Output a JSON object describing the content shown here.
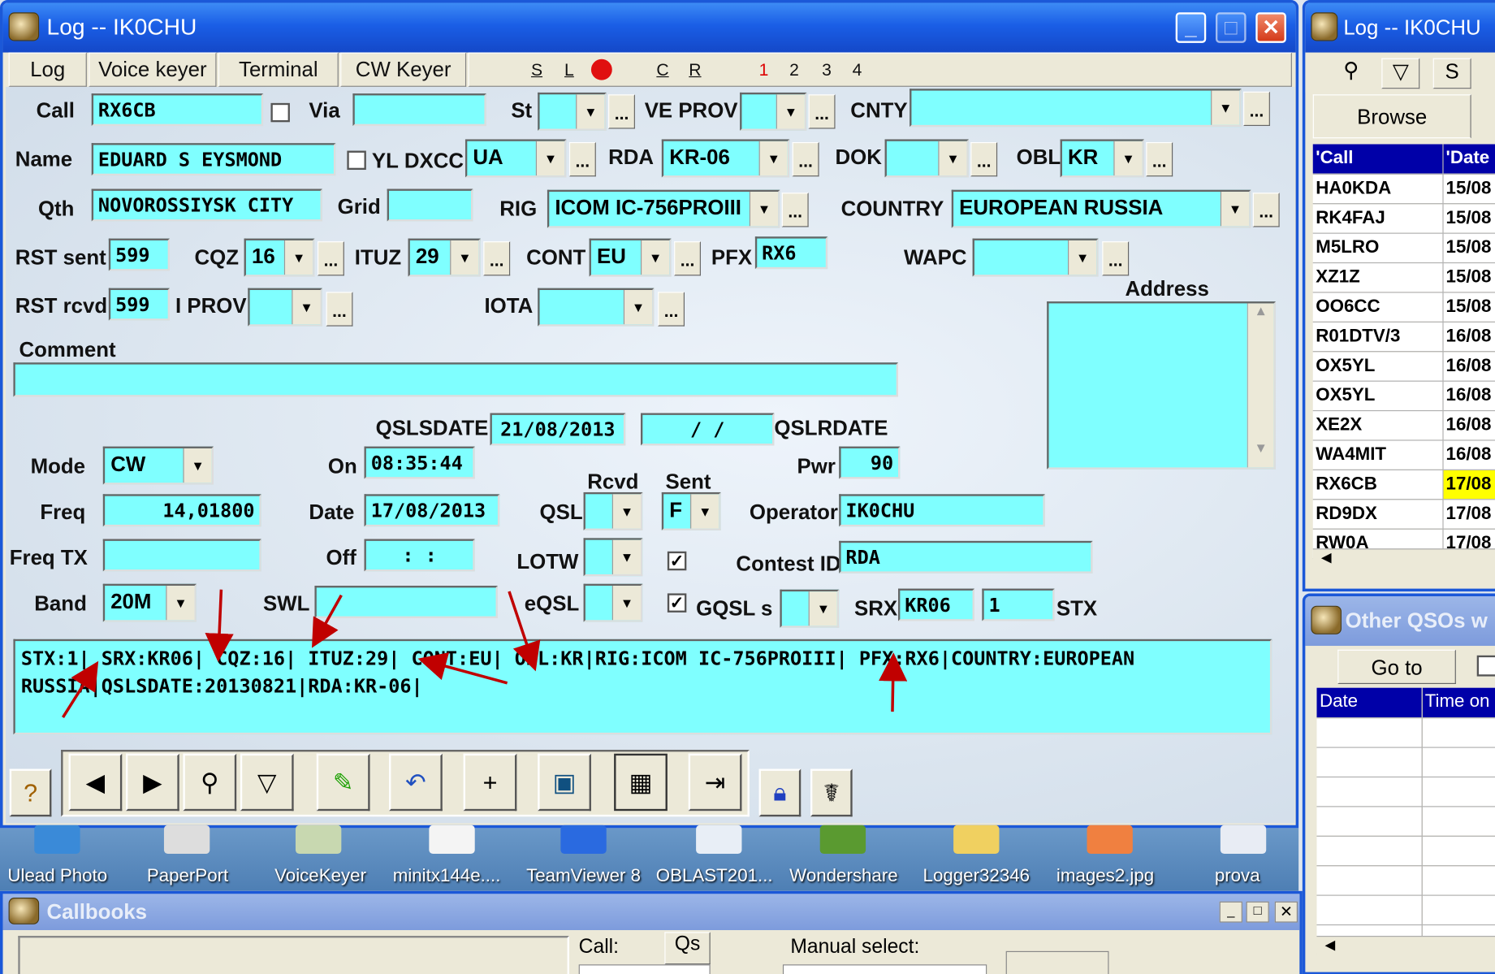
{
  "main_window": {
    "title": "Log -- IK0CHU"
  },
  "menu": {
    "tabs": [
      "Log",
      "Voice keyer",
      "Terminal",
      "CW Keyer"
    ],
    "mini": [
      "S",
      "L",
      "C",
      "R",
      "1",
      "2",
      "3",
      "4"
    ]
  },
  "labels": {
    "call": "Call",
    "via": "Via",
    "st": "St",
    "ve_prov": "VE PROV",
    "cnty": "CNTY",
    "name": "Name",
    "yl": "YL",
    "dxcc": "DXCC",
    "rda": "RDA",
    "dok": "DOK",
    "obl": "OBL",
    "qth": "Qth",
    "grid": "Grid",
    "rig": "RIG",
    "country": "COUNTRY",
    "rst_sent": "RST sent",
    "cqz": "CQZ",
    "ituz": "ITUZ",
    "cont": "CONT",
    "pfx": "PFX",
    "wapc": "WAPC",
    "rst_rcvd": "RST rcvd",
    "i_prov": "I PROV",
    "iota": "IOTA",
    "address": "Address",
    "comment": "Comment",
    "qslsdate": "QSLSDATE",
    "qslrdate": "QSLRDATE",
    "mode": "Mode",
    "on": "On",
    "pwr": "Pwr",
    "rcvd": "Rcvd",
    "sent": "Sent",
    "freq": "Freq",
    "date": "Date",
    "qsl": "QSL",
    "operator": "Operator",
    "freq_tx": "Freq TX",
    "off": "Off",
    "lotw": "LOTW",
    "contest_id": "Contest ID",
    "band": "Band",
    "swl": "SWL",
    "eqsl": "eQSL",
    "gqsl": "GQSL s",
    "srx": "SRX",
    "stx": "STX"
  },
  "values": {
    "call": "RX6CB",
    "via": "",
    "st": "",
    "ve_prov": "",
    "cnty": "",
    "name": "EDUARD S EYSMOND",
    "dxcc": "UA",
    "rda": "KR-06",
    "dok": "",
    "obl": "KR",
    "qth": "NOVOROSSIYSK CITY",
    "grid": "",
    "rig": "ICOM IC-756PROIII",
    "country": "EUROPEAN RUSSIA",
    "rst_sent": "599",
    "cqz": "16",
    "ituz": "29",
    "cont": "EU",
    "pfx": "RX6",
    "wapc": "",
    "rst_rcvd": "599",
    "i_prov": "",
    "iota": "",
    "qslsdate": "21/08/2013",
    "qslrdate": "/  /",
    "mode": "CW",
    "on": "08:35:44",
    "pwr": "90",
    "freq": "14,01800",
    "date": "17/08/2013",
    "qsl_rcvd": "",
    "qsl_sent": "F",
    "operator": "IK0CHU",
    "freq_tx": "",
    "off": ":   :",
    "contest_id": "RDA",
    "band": "20M",
    "swl": "",
    "srx": "KR06",
    "stx": "1",
    "notes": "STX:1| SRX:KR06| CQZ:16| ITUZ:29| CONT:EU| OBL:KR|RIG:ICOM IC-756PROIII| PFX:RX6|COUNTRY:EUROPEAN RUSSIA|QSLSDATE:20130821|RDA:KR-06|"
  },
  "dots": "...",
  "desktop": [
    "Ulead Photo",
    "PaperPort",
    "VoiceKeyer",
    "minitx144e....",
    "TeamViewer 8",
    "OBLAST201...",
    "Wondershare",
    "Logger32346",
    "images2.jpg",
    "prova"
  ],
  "callbooks": {
    "title": "Callbooks",
    "call_label": "Call:",
    "qs_button": "Qs",
    "manual_label": "Manual select:"
  },
  "side_log": {
    "title": "Log -- IK0CHU",
    "browse": "Browse",
    "s_button": "S",
    "headers": [
      "'Call",
      "'Date"
    ],
    "rows": [
      [
        "HA0KDA",
        "15/08"
      ],
      [
        "RK4FAJ",
        "15/08"
      ],
      [
        "M5LRO",
        "15/08"
      ],
      [
        "XZ1Z",
        "15/08"
      ],
      [
        "OO6CC",
        "15/08"
      ],
      [
        "R01DTV/3",
        "16/08"
      ],
      [
        "OX5YL",
        "16/08"
      ],
      [
        "OX5YL",
        "16/08"
      ],
      [
        "XE2X",
        "16/08"
      ],
      [
        "WA4MIT",
        "16/08"
      ],
      [
        "RX6CB",
        "17/08"
      ],
      [
        "RD9DX",
        "17/08"
      ],
      [
        "RW0A",
        "17/08"
      ]
    ]
  },
  "other_qsos": {
    "title": "Other QSOs w",
    "goto": "Go to",
    "headers": [
      "Date",
      "Time on"
    ]
  },
  "colors": {
    "field": "#7fffff",
    "title": "#1a5ee6",
    "highlight": "#ffff00",
    "header": "#0000a8",
    "arrow": "#c00000"
  }
}
